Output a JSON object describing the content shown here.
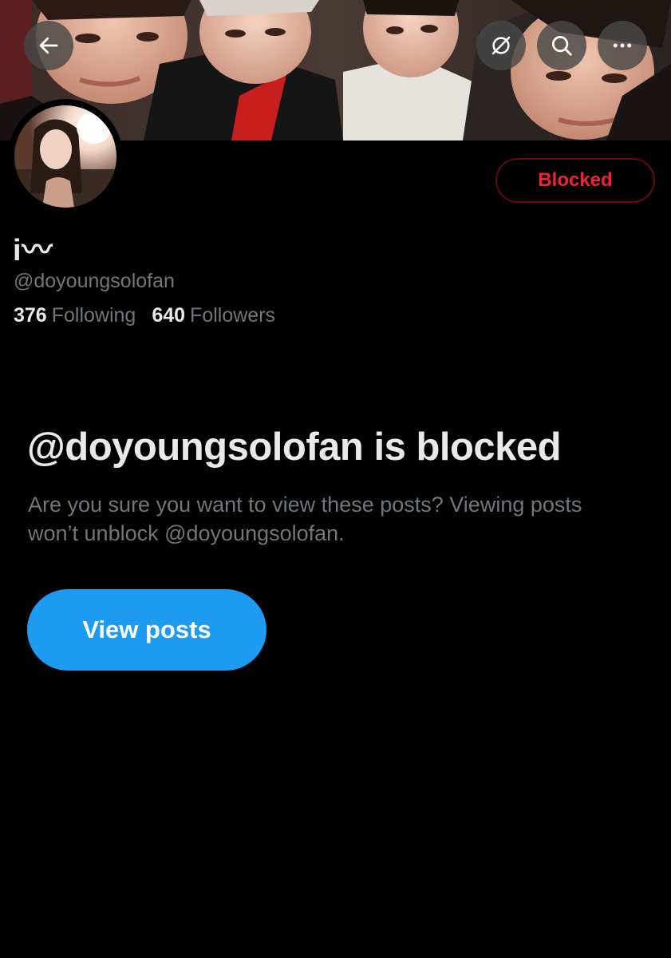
{
  "header": {
    "back_icon": "arrow-left-icon",
    "grok_icon": "grok-icon",
    "search_icon": "search-icon",
    "more_icon": "more-horizontal-icon"
  },
  "profile": {
    "display_name": "i〰",
    "handle": "@doyoungsolofan",
    "following_count": "376",
    "following_label": "Following",
    "followers_count": "640",
    "followers_label": "Followers",
    "blocked_button_label": "Blocked"
  },
  "blocked_notice": {
    "title": "@doyoungsolofan is blocked",
    "description": "Are you sure you want to view these posts? Viewing posts won’t unblock @doyoungsolofan.",
    "view_posts_label": "View posts"
  },
  "colors": {
    "background": "#000000",
    "primary_text": "#e7e9ea",
    "secondary_text": "#71767b",
    "blocked_red": "#f4212e",
    "accent_blue": "#1d9bf0"
  }
}
